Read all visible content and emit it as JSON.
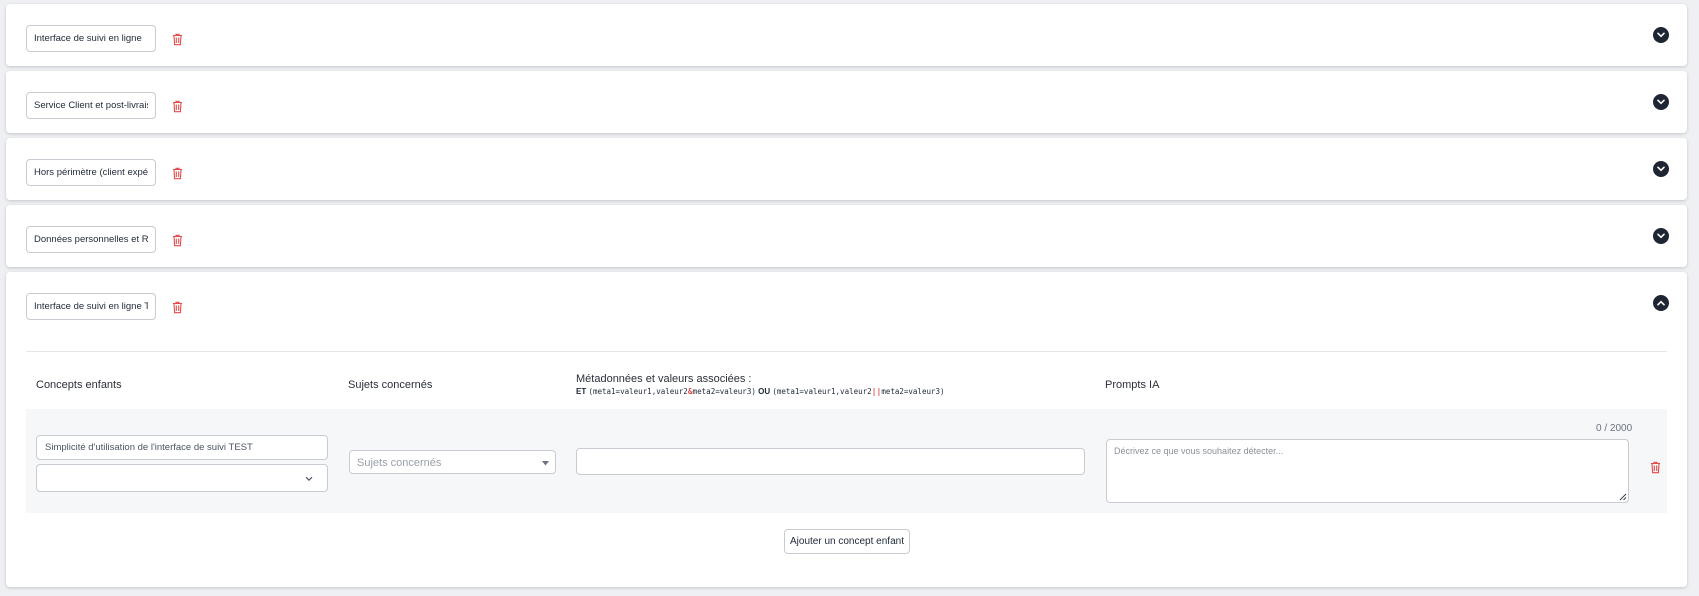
{
  "categories": [
    {
      "name": "Interface de suivi en ligne",
      "expanded": false
    },
    {
      "name": "Service Client et post-livraison",
      "expanded": false
    },
    {
      "name": "Hors périmètre (client expéditeur)",
      "expanded": false
    },
    {
      "name": "Données personnelles et RGPD",
      "expanded": false
    },
    {
      "name": "Interface de suivi en ligne TEST",
      "expanded": true
    }
  ],
  "expanded": {
    "columns": {
      "concepts": "Concepts enfants",
      "sujets": "Sujets concernés",
      "metadata": "Métadonnées et valeurs associées :",
      "prompts": "Prompts IA"
    },
    "metadata_help": {
      "et": "ET",
      "et_expr_1": "(meta1=valeur1",
      "et_expr_2": ",valeur2",
      "et_amp": "&",
      "et_expr_3": "meta2=valeur3)",
      "ou": "OU",
      "ou_expr_1": "(meta1=valeur1",
      "ou_expr_2": ",valeur2",
      "ou_pipe": "||",
      "ou_expr_3": "meta2=valeur3)"
    },
    "row": {
      "concept_name": "Simplicité d'utilisation de l'interface de suivi TEST",
      "concept_type": "",
      "sujets_placeholder": "Sujets concernés",
      "metadata_value": "",
      "prompt_value": "",
      "prompt_placeholder": "Décrivez ce que vous souhaitez détecter...",
      "counter": "0 / 2000"
    },
    "add_button": "Ajouter un concept enfant"
  },
  "colors": {
    "trash": "#e34b4b",
    "chevron_bg": "#1f2633",
    "operator_red": "#e34b4b"
  },
  "icons": {
    "delete": "trash-icon",
    "toggle_collapsed": "chevron-down-icon",
    "toggle_expanded": "chevron-up-icon",
    "select": "caret-down-icon"
  }
}
